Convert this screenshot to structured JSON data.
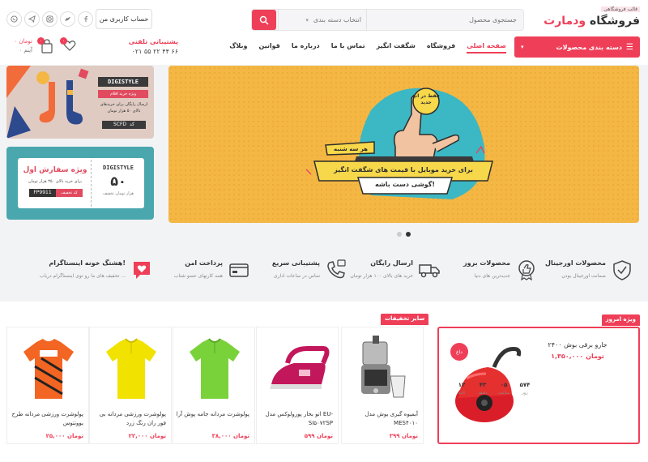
{
  "header": {
    "logo_tag": "قالب فروشگاهی",
    "logo_name_1": "فروشگاه",
    "logo_name_2": "ودمارت",
    "search_placeholder": "جستجوی محصول",
    "search_category": "انتخاب دسته بندی",
    "account_label": "حساب کاربری من",
    "social_icons": [
      "whatsapp-icon",
      "telegram-icon",
      "instagram-icon",
      "twitter-icon",
      "facebook-icon"
    ]
  },
  "nav": {
    "categories_label": "دسته بندی محصولات",
    "items": [
      "صفحه اصلی",
      "فروشگاه",
      "شگفت انگیز",
      "تماس با ما",
      "درباره ما",
      "قوانین",
      "وبلاگ"
    ],
    "support_title": "پشتیبانی تلفنی",
    "support_phone": "۰۲۱ ۵۵ ۲۲ ۴۴ ۶۶",
    "cart_price": "۰ تومان",
    "cart_items": "۰ آیتم",
    "cart_badge": "۰",
    "wishlist_badge": "۰"
  },
  "side_banner_1": {
    "brand": "DIGISTYLE",
    "ribbon": "ویژه خرید اقلام",
    "text": "ارسال رایگان برای خریدهای بالای ۵۰ هزار تومان",
    "code_label": "کد",
    "code": "SCFD"
  },
  "side_banner_2": {
    "title": "ویژه سفارش اول",
    "subtitle": "برای خرید بالای ۳۵۰ هزار تومان",
    "code": "FP9911",
    "code_label": "کد تخفیف",
    "brand": "DIGISTYLE",
    "amount": "۵۰",
    "amount_unit": "هزار تومان تخفیف"
  },
  "hero": {
    "speech": "فقط در اپ جدید",
    "day": "هر سه شنبه",
    "line1": "برای خرید موبایل با قیمت های شگفت انگیز",
    "line2": "گوشی دست باشه!"
  },
  "features": [
    {
      "title": "محصولات اورجینال",
      "sub": "ضمانت اورجینال بودن",
      "icon": "shield-check-icon"
    },
    {
      "title": "محصولات بروز",
      "sub": "جدیدترین های دنیا",
      "icon": "thumbs-up-icon"
    },
    {
      "title": "ارسال رایگان",
      "sub": "خرید های بالای ۱۰۰ هزار تومان",
      "icon": "truck-icon"
    },
    {
      "title": "پشتیبانی سریع",
      "sub": "تماس در ساعات اداری",
      "icon": "phone-icon"
    },
    {
      "title": "پرداخت امن",
      "sub": "همه کارتهای عضو شتاب",
      "icon": "credit-card-icon"
    },
    {
      "title": "هشتگ خونه اینستاگرام!",
      "sub": "تخفیف های ما رو توی اینستاگرام دریاب ...",
      "icon": "instagram-heart-icon"
    }
  ],
  "special": {
    "tag": "ویژه امروز",
    "product_name": "جارو برقی بوش ۲۴۰۰",
    "old_price": "۱,۳۵۰,۰۰۰ تومان",
    "badge": "داغ",
    "countdown": [
      {
        "value": "۵۷۴",
        "label": "روز"
      },
      {
        "value": "۰۵",
        "label": "ساعت"
      },
      {
        "value": "۴۳",
        "label": "دقیقه"
      },
      {
        "value": "۱۲",
        "label": "ثانیه"
      }
    ]
  },
  "others": {
    "tag": "سایر تخفیفات",
    "products": [
      {
        "name": "آبمیوه گیری بوش مدل MES۴۰۱۰",
        "price": "۳۹۹ تومان",
        "kind": "juicer"
      },
      {
        "name": "اتو بخار پورولوکس مدل EU-SI۵۰۷۲SP",
        "price": "۵۹۹ تومان",
        "kind": "iron"
      },
      {
        "name": "پولوشرت مردانه جامه پوش آرا",
        "price": "۳۸,۰۰۰ تومان",
        "kind": "green-shirt"
      },
      {
        "name": "پولوشرت ورزشی مردانه بی فور ران رنگ زرد",
        "price": "۲۲,۰۰۰ تومان",
        "kind": "yellow-shirt"
      },
      {
        "name": "پولوشرت ورزشی مردانه طرح یوونتوس",
        "price": "۲۵,۰۰۰ تومان",
        "kind": "jersey"
      }
    ]
  },
  "colors": {
    "accent": "#ef3f58",
    "hero_bg": "#f4b744"
  }
}
